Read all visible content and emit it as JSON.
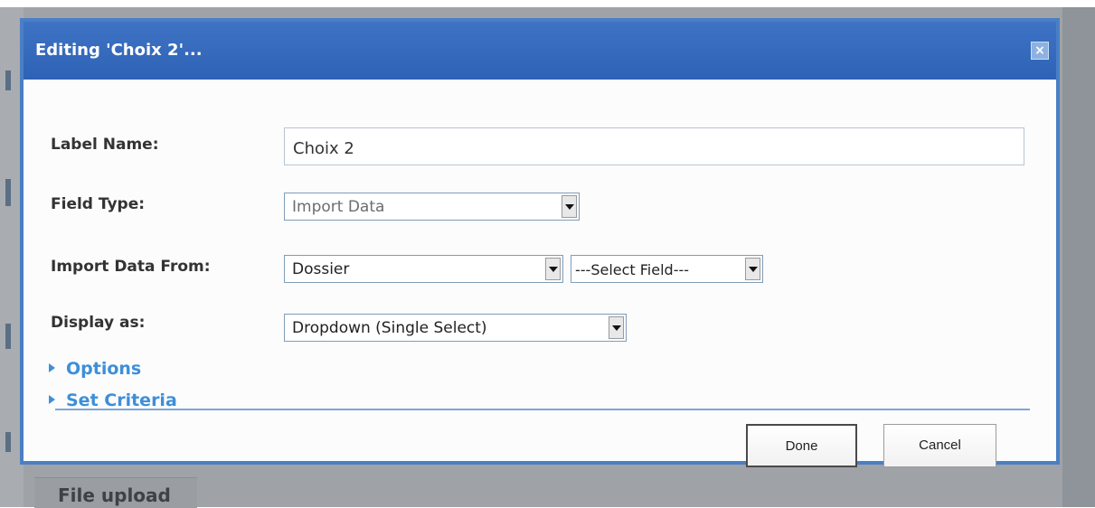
{
  "dialog": {
    "title": "Editing 'Choix 2'...",
    "close_icon": "close-icon"
  },
  "form": {
    "label_name": {
      "label": "Label Name:",
      "value": "Choix 2"
    },
    "field_type": {
      "label": "Field Type:",
      "selected": "Import Data"
    },
    "import_data_from": {
      "label": "Import Data From:",
      "source_selected": "Dossier",
      "field_selected": "---Select Field---"
    },
    "display_as": {
      "label": "Display as:",
      "selected": "Dropdown (Single Select)"
    }
  },
  "sections": [
    {
      "label": "Options",
      "icon": "triangle-right-icon"
    },
    {
      "label": "Set Criteria",
      "icon": "triangle-right-icon"
    }
  ],
  "buttons": {
    "done": "Done",
    "cancel": "Cancel"
  },
  "background": {
    "partial_text": "File upload"
  },
  "colors": {
    "header": "#2e62b6",
    "frame": "#4a7fc4",
    "link": "#3d8fd9",
    "backdrop": "#9fa3a8"
  }
}
